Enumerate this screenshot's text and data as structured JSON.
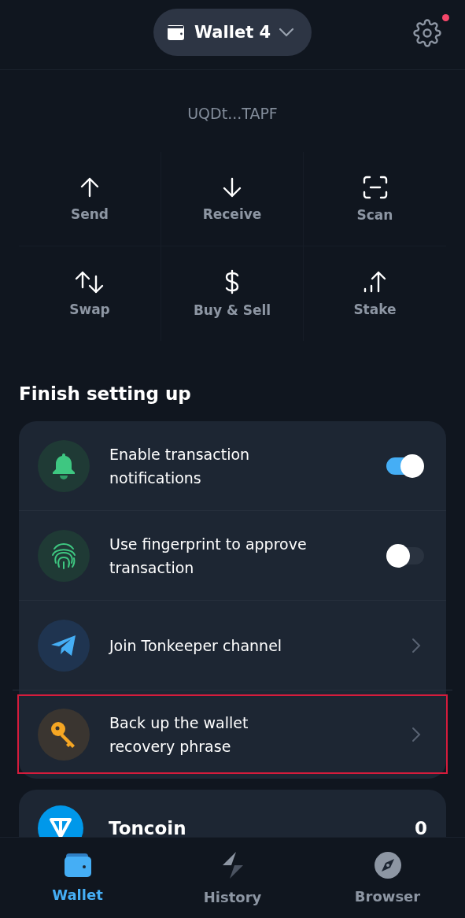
{
  "header": {
    "wallet_name": "Wallet 4",
    "settings_notification": true
  },
  "balance": {
    "address": "UQDt...TAPF"
  },
  "actions": [
    {
      "kind": "send",
      "label": "Send"
    },
    {
      "kind": "receive",
      "label": "Receive"
    },
    {
      "kind": "scan",
      "label": "Scan"
    },
    {
      "kind": "swap",
      "label": "Swap"
    },
    {
      "kind": "buy",
      "label": "Buy & Sell"
    },
    {
      "kind": "stake",
      "label": "Stake"
    }
  ],
  "setup": {
    "title": "Finish setting up",
    "items": [
      {
        "kind": "toggle",
        "label": "Enable transaction notifications",
        "on": true,
        "highlighted": false
      },
      {
        "kind": "toggle",
        "label": "Use fingerprint to approve transaction",
        "on": false,
        "highlighted": false
      },
      {
        "kind": "link",
        "label": "Join Tonkeeper channel",
        "highlighted": false
      },
      {
        "kind": "link",
        "label": "Back up the wallet recovery phrase",
        "highlighted": true
      }
    ]
  },
  "tokens": [
    {
      "name": "Toncoin",
      "amount": "0"
    }
  ],
  "tabs": [
    {
      "kind": "wallet",
      "label": "Wallet",
      "selected": true
    },
    {
      "kind": "history",
      "label": "History",
      "selected": false
    },
    {
      "kind": "browser",
      "label": "Browser",
      "selected": false
    }
  ]
}
